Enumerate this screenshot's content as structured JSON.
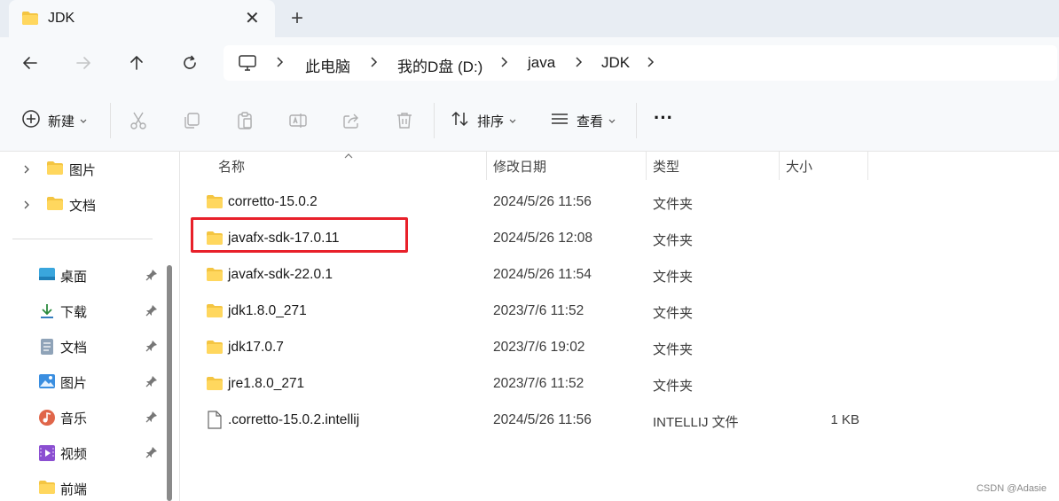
{
  "window": {
    "tab_title": "JDK",
    "close_glyph": "✕",
    "newtab_glyph": "+"
  },
  "address": {
    "crumbs": [
      "此电脑",
      "我的D盘 (D:)",
      "java",
      "JDK"
    ]
  },
  "commands": {
    "new_label": "新建",
    "sort_label": "排序",
    "view_label": "查看",
    "more_label": "···"
  },
  "sidebar": {
    "top_items": [
      {
        "label": "图片",
        "icon": "folder-icon"
      },
      {
        "label": "文档",
        "icon": "folder-icon"
      }
    ],
    "quick_access": [
      {
        "label": "桌面",
        "icon": "desktop-icon",
        "pinned": true
      },
      {
        "label": "下载",
        "icon": "download-icon",
        "pinned": true
      },
      {
        "label": "文档",
        "icon": "document-icon",
        "pinned": true
      },
      {
        "label": "图片",
        "icon": "picture-icon",
        "pinned": true
      },
      {
        "label": "音乐",
        "icon": "music-icon",
        "pinned": true
      },
      {
        "label": "视频",
        "icon": "video-icon",
        "pinned": true
      },
      {
        "label": "前端",
        "icon": "folder-icon",
        "pinned": false
      }
    ]
  },
  "columns": {
    "name": "名称",
    "date": "修改日期",
    "type": "类型",
    "size": "大小"
  },
  "files": [
    {
      "name": "corretto-15.0.2",
      "date": "2024/5/26 11:56",
      "type": "文件夹",
      "size": "",
      "kind": "folder"
    },
    {
      "name": "javafx-sdk-17.0.11",
      "date": "2024/5/26 12:08",
      "type": "文件夹",
      "size": "",
      "kind": "folder"
    },
    {
      "name": "javafx-sdk-22.0.1",
      "date": "2024/5/26 11:54",
      "type": "文件夹",
      "size": "",
      "kind": "folder"
    },
    {
      "name": "jdk1.8.0_271",
      "date": "2023/7/6 11:52",
      "type": "文件夹",
      "size": "",
      "kind": "folder"
    },
    {
      "name": "jdk17.0.7",
      "date": "2023/7/6 19:02",
      "type": "文件夹",
      "size": "",
      "kind": "folder"
    },
    {
      "name": "jre1.8.0_271",
      "date": "2023/7/6 11:52",
      "type": "文件夹",
      "size": "",
      "kind": "folder"
    },
    {
      "name": ".corretto-15.0.2.intellij",
      "date": "2024/5/26 11:56",
      "type": "INTELLIJ 文件",
      "size": "1 KB",
      "kind": "file"
    }
  ],
  "watermark": "CSDN @Adasie",
  "colors": {
    "folder": "#f4c542",
    "highlight": "#e8202a",
    "tabstrip": "#e8edf3",
    "chrome": "#f7f9fb"
  }
}
